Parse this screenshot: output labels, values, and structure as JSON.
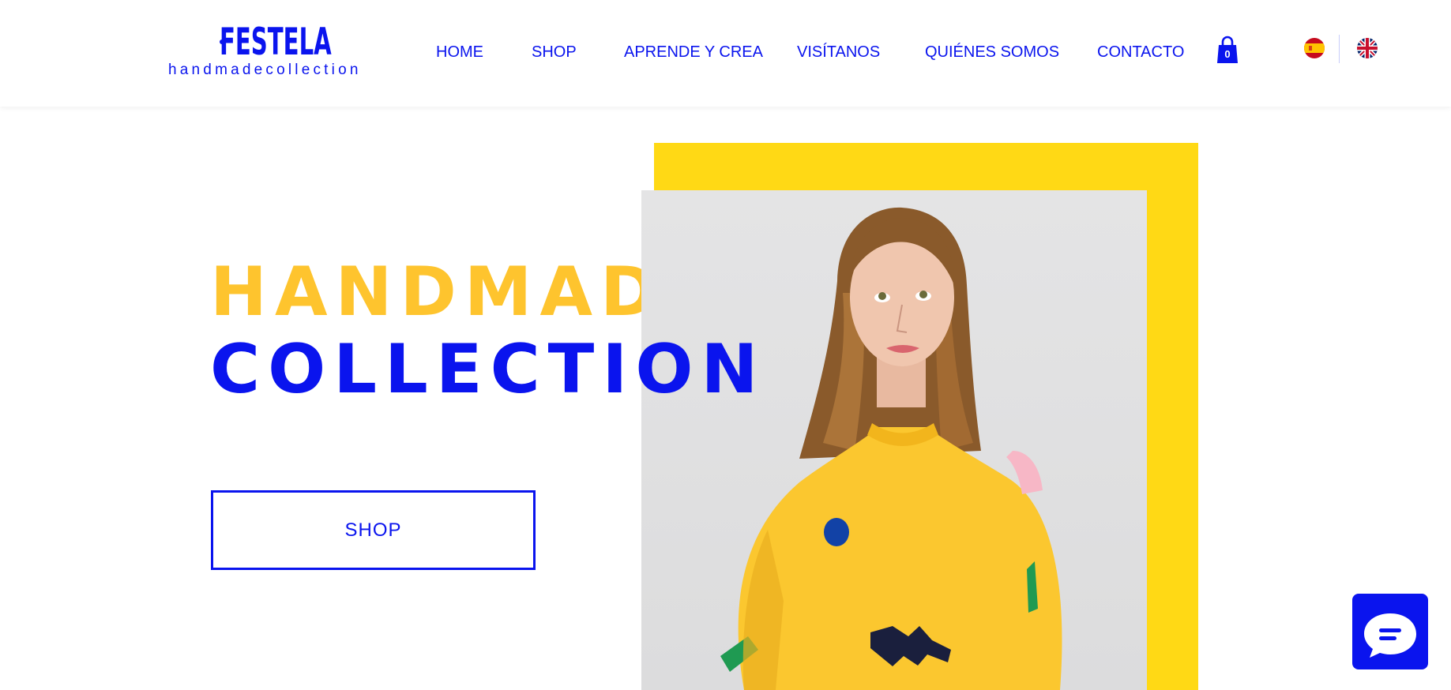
{
  "header": {
    "logo": {
      "name": "FESTELA",
      "tagline": "handmadecollection"
    },
    "nav": [
      {
        "label": "HOME"
      },
      {
        "label": "SHOP"
      },
      {
        "label": "APRENDE Y CREA"
      },
      {
        "label": "VISÍTANOS"
      },
      {
        "label": "QUIÉNES SOMOS"
      },
      {
        "label": "CONTACTO"
      }
    ],
    "cart": {
      "count": "0",
      "icon": "shopping-bag-icon"
    },
    "languages": [
      {
        "code": "es",
        "icon": "spain-flag-icon"
      },
      {
        "code": "en",
        "icon": "uk-flag-icon"
      }
    ]
  },
  "hero": {
    "title_line1": "HANDMADE",
    "title_line2": "COLLECTION",
    "cta_label": "SHOP",
    "image_alt": "Woman wearing a yellow sweatshirt with colorful appliqué shapes"
  },
  "chat": {
    "icon": "chat-bubble-icon"
  },
  "colors": {
    "primary_blue": "#0a14ee",
    "accent_yellow": "#fec42e",
    "frame_yellow": "#ffd915",
    "background": "#ffffff"
  }
}
